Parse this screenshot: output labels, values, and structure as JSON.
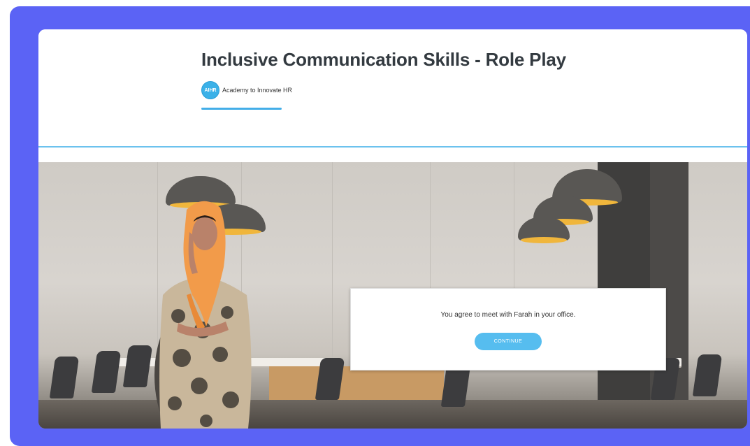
{
  "course": {
    "title": "Inclusive Communication Skills - Role Play",
    "author": {
      "logo_text": "AIHR",
      "name": "Academy to Innovate HR"
    }
  },
  "scene": {
    "dialog": {
      "message": "You agree to meet with Farah in your office.",
      "continue_label": "CONTINUE"
    }
  },
  "colors": {
    "frame": "#5b63f5",
    "accent": "#43aee8",
    "button": "#56bdef",
    "lamp_rim": "#f0b63c"
  }
}
